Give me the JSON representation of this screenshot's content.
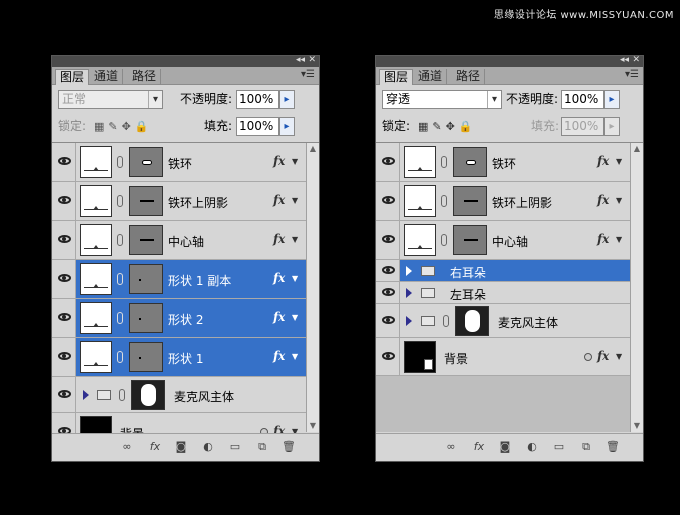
{
  "watermark": "思缘设计论坛 www.MISSYUAN.COM",
  "panels": [
    {
      "tabs": [
        "图层",
        "通道",
        "路径"
      ],
      "blend_mode": "正常",
      "opacity_label": "不透明度:",
      "opacity": "100%",
      "lock_label": "锁定:",
      "fill_label": "填充:",
      "fill": "100%",
      "layers": [
        {
          "name": "铁环",
          "fx": "fx"
        },
        {
          "name": "铁环上阴影",
          "fx": "fx"
        },
        {
          "name": "中心轴",
          "fx": "fx"
        },
        {
          "name": "形状 1 副本",
          "fx": "fx"
        },
        {
          "name": "形状 2",
          "fx": "fx"
        },
        {
          "name": "形状 1",
          "fx": "fx"
        },
        {
          "name": "麦克风主体"
        },
        {
          "name": "背景",
          "fx": "fx"
        }
      ]
    },
    {
      "tabs": [
        "图层",
        "通道",
        "路径"
      ],
      "blend_mode": "穿透",
      "opacity_label": "不透明度:",
      "opacity": "100%",
      "lock_label": "锁定:",
      "fill_label": "填充:",
      "fill": "100%",
      "layers": [
        {
          "name": "铁环",
          "fx": "fx"
        },
        {
          "name": "铁环上阴影",
          "fx": "fx"
        },
        {
          "name": "中心轴",
          "fx": "fx"
        },
        {
          "name": "右耳朵"
        },
        {
          "name": "左耳朵"
        },
        {
          "name": "麦克风主体"
        },
        {
          "name": "背景",
          "fx": "fx"
        }
      ]
    }
  ],
  "footer_icons": [
    "link-icon",
    "fx-icon",
    "mask-icon",
    "adjustment-icon",
    "folder-icon",
    "new-layer-icon",
    "trash-icon"
  ]
}
